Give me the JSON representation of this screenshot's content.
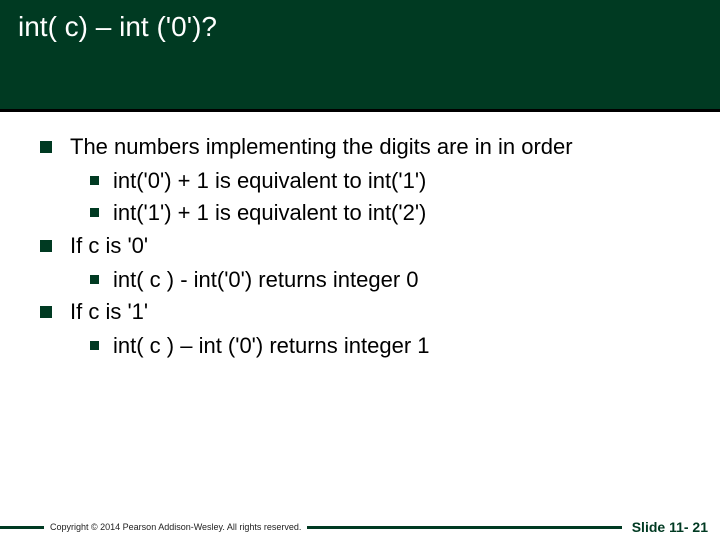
{
  "title": "int( c) – int ('0')?",
  "bullets": {
    "b1": "The numbers implementing the digits are in in order",
    "b1a": "int('0') + 1 is equivalent to int('1')",
    "b1b": "int('1') + 1 is equivalent to int('2')",
    "b2": "If c is '0'",
    "b2a": "int( c ) - int('0') returns integer 0",
    "b3": "If c is '1'",
    "b3a": "int( c ) – int ('0')  returns integer 1"
  },
  "footer": {
    "copyright": "Copyright © 2014 Pearson Addison-Wesley.  All rights reserved.",
    "slidenum": "Slide 11- 21"
  }
}
